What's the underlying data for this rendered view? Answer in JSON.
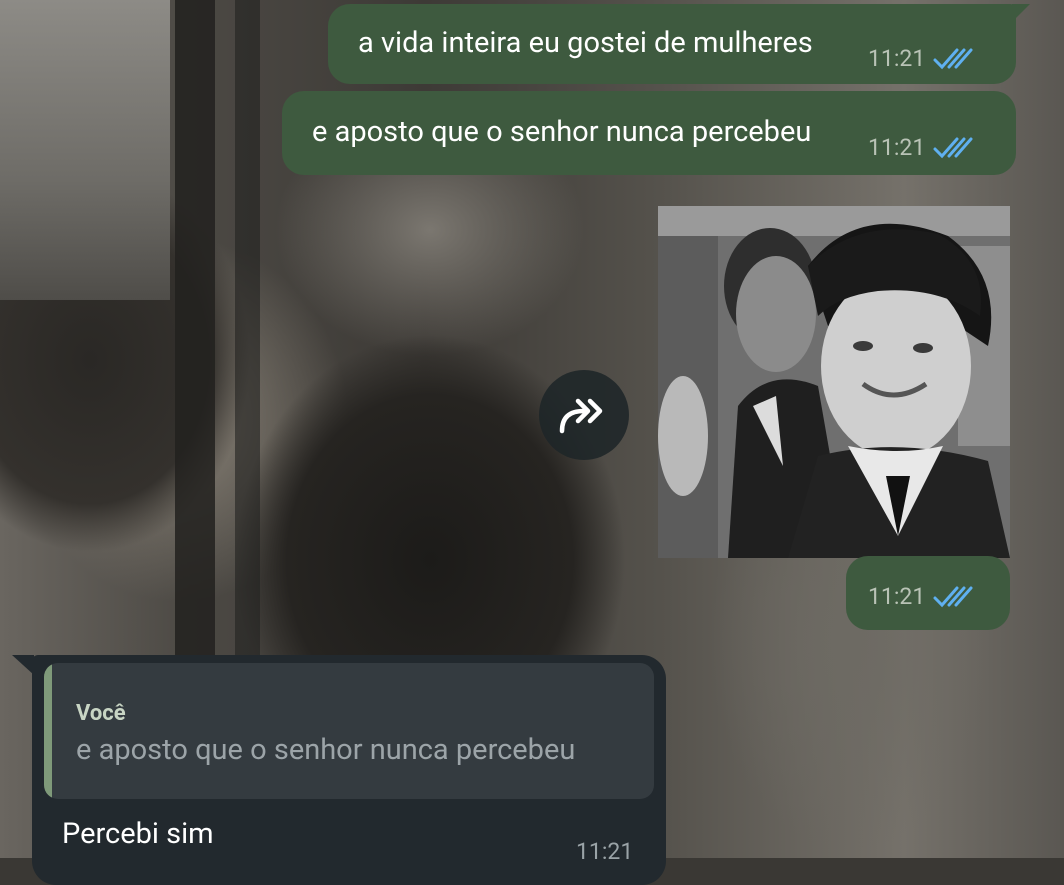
{
  "messages": [
    {
      "type": "outgoing",
      "text": "a vida inteira eu gostei de mulheres",
      "time": "11:21",
      "status": "read"
    },
    {
      "type": "outgoing",
      "text": "e aposto que o senhor nunca percebeu",
      "time": "11:21",
      "status": "read"
    },
    {
      "type": "outgoing-media",
      "media": "photo",
      "time": "11:21",
      "status": "read"
    },
    {
      "type": "incoming",
      "reply_author": "Você",
      "reply_text": "e aposto que o senhor nunca percebeu",
      "text": "Percebi sim",
      "time": "11:21"
    }
  ],
  "icons": {
    "forward": "forward-arrow-icon",
    "read": "double-check-icon"
  },
  "colors": {
    "outgoing_bubble": "#3e5a3f",
    "incoming_bubble": "#22292e",
    "read_ticks": "#5fb0f0",
    "quote_bar": "#7f9a7a"
  }
}
